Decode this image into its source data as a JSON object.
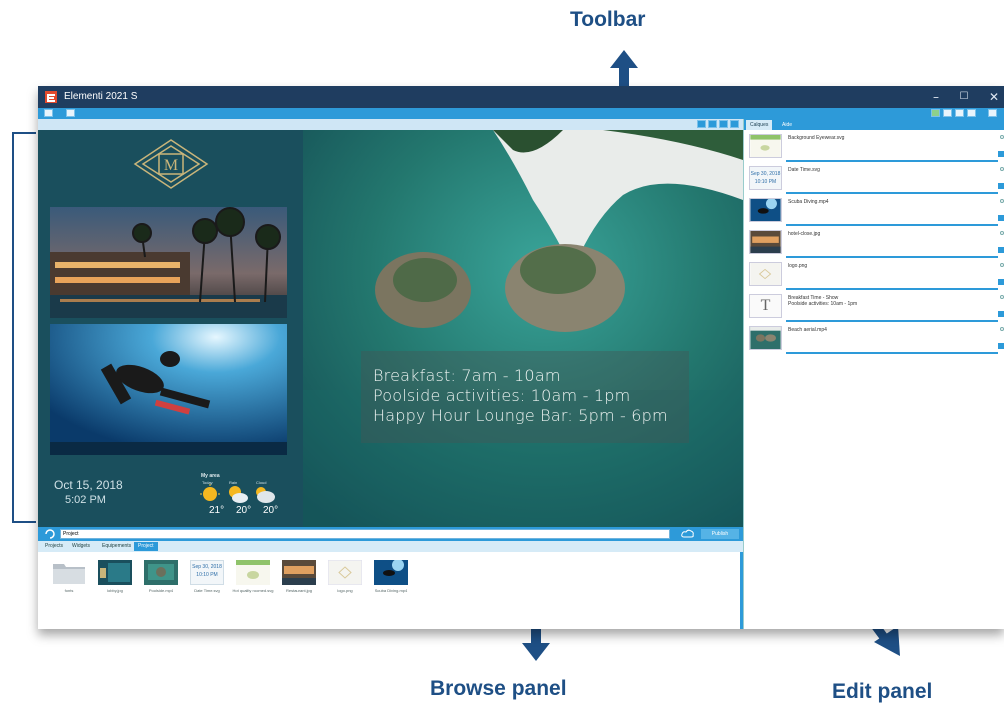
{
  "callouts": {
    "toolbar": "Toolbar",
    "browse": "Browse panel",
    "edit": "Edit panel"
  },
  "window": {
    "title": "Elementi 2021 S",
    "minimize": "–",
    "maximize": "☐",
    "close": "✕"
  },
  "preview": {
    "date": "Oct 15, 2018",
    "time": "5:02 PM",
    "weather": {
      "title": "My area",
      "days": [
        {
          "label": "Today",
          "temp": "21°"
        },
        {
          "label": "Rain",
          "temp": "20°"
        },
        {
          "label": "Cloud",
          "temp": "20°"
        }
      ]
    },
    "overlay": [
      "Breakfast: 7am - 10am",
      "Poolside activities: 10am - 1pm",
      "Happy Hour Lounge Bar: 5pm - 6pm"
    ]
  },
  "browse": {
    "search_value": "Project",
    "publish_label": "Publish",
    "tabs": [
      "Projects",
      "Widgets",
      "Equipements",
      "Project"
    ],
    "items": [
      {
        "label": "fonts"
      },
      {
        "label": "lobby.jpg"
      },
      {
        "label": "Poolside.mp4"
      },
      {
        "label": "Date Time.svg"
      },
      {
        "label": "Hot quality roomed.svg"
      },
      {
        "label": "Restaurant.jpg"
      },
      {
        "label": "logo.png"
      },
      {
        "label": "Scuba Diving.mp4"
      }
    ],
    "date_thumb_date": "Sep 30, 2018",
    "date_thumb_time": "10:10 PM"
  },
  "edit": {
    "tabs": [
      "Calques",
      "Aide"
    ],
    "items": [
      {
        "name": "Background Eyewear.svg"
      },
      {
        "name": "Date Time.svg"
      },
      {
        "name": "Scuba Diving.mp4"
      },
      {
        "name": "hotel-close.jpg"
      },
      {
        "name": "logo.png"
      },
      {
        "name": "Breakfast Time - Show",
        "sub": "Poolside activities: 10am - 1pm"
      },
      {
        "name": "Beach aerial.mp4"
      }
    ],
    "date_thumb_date": "Sep 30, 2018",
    "date_thumb_time": "10:10 PM",
    "text_glyph": "T"
  },
  "colors": {
    "titlebar": "#1f3d60",
    "accent": "#2d9ad9",
    "teal": "#1a4f5d",
    "callout": "#1e4f85"
  }
}
